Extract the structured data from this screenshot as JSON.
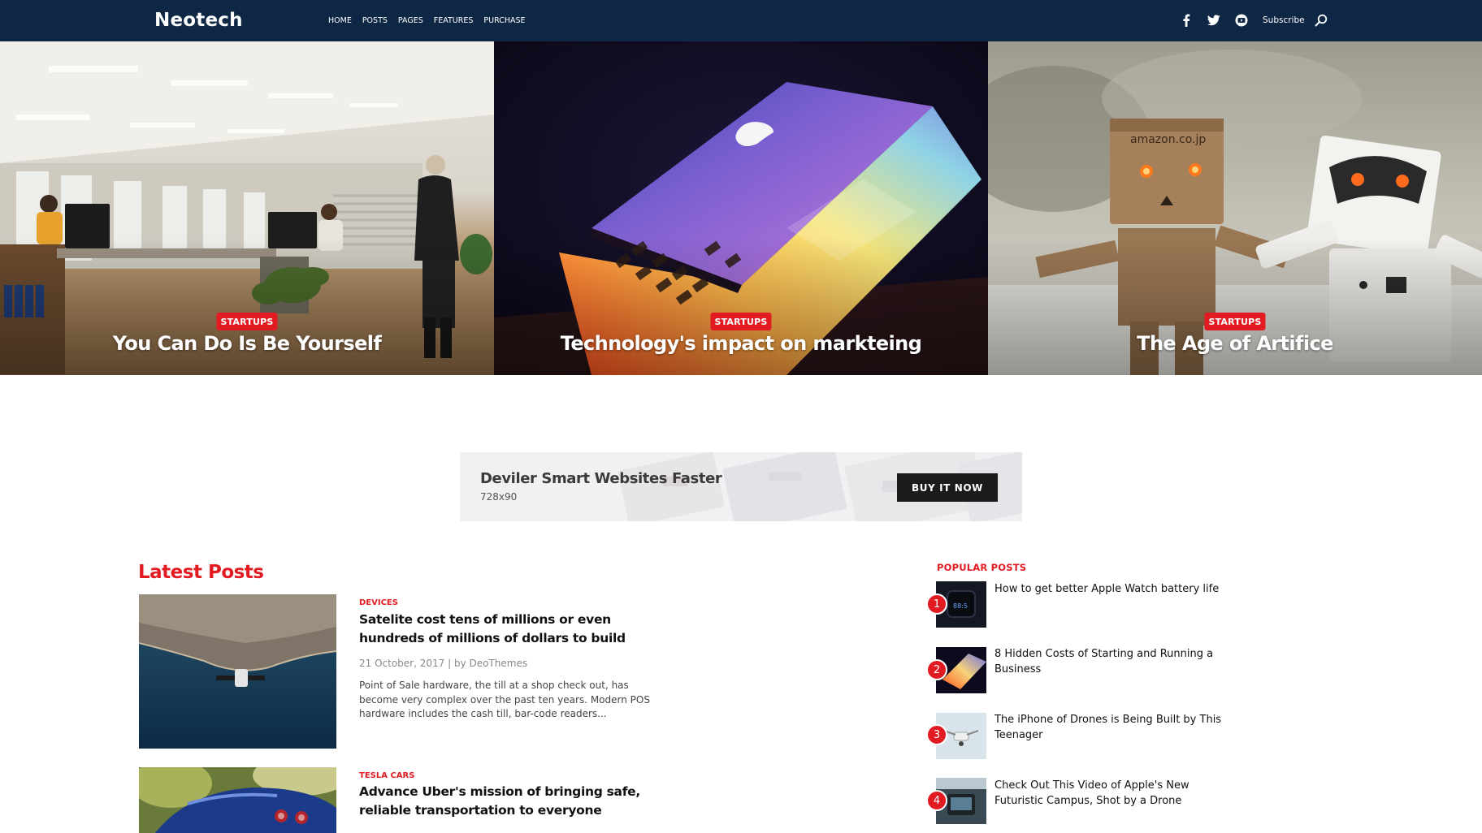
{
  "brand": {
    "logo": "Neotech"
  },
  "nav": {
    "items": [
      "HOME",
      "POSTS",
      "PAGES",
      "FEATURES",
      "PURCHASE"
    ],
    "subscribe_label": "Subscribe",
    "icons": [
      "facebook-icon",
      "twitter-icon",
      "youtube-icon",
      "search-icon"
    ]
  },
  "hero": [
    {
      "category": "STARTUPS",
      "title": "You Can Do Is Be Yourself"
    },
    {
      "category": "STARTUPS",
      "title": "Technology's impact on markteing"
    },
    {
      "category": "STARTUPS",
      "title": "The Age of Artifice"
    }
  ],
  "ad": {
    "title": "Deviler Smart Websites Faster",
    "size": "728x90",
    "button": "BUY IT NOW"
  },
  "latest": {
    "heading": "Latest Posts",
    "posts": [
      {
        "category": "DEVICES",
        "title": "Satelite cost tens of millions or even hundreds of millions of dollars to build",
        "meta": "21 October, 2017 | by DeoThemes",
        "excerpt": "Point of Sale hardware, the till at a shop check out, has become very complex over the past ten years. Modern POS hardware includes the cash till, bar-code readers..."
      },
      {
        "category": "TESLA CARS",
        "title": "Advance Uber's mission of bringing safe, reliable transportation to everyone"
      }
    ]
  },
  "popular": {
    "heading": "POPULAR POSTS",
    "items": [
      {
        "number": "1",
        "title": "How to get better Apple Watch battery life"
      },
      {
        "number": "2",
        "title": "8 Hidden Costs of Starting and Running a Business"
      },
      {
        "number": "3",
        "title": "The iPhone of Drones is Being Built by This Teenager"
      },
      {
        "number": "4",
        "title": "Check Out This Video of Apple's New Futuristic Campus, Shot by a Drone"
      }
    ]
  },
  "colors": {
    "nav_bg": "#0d2744",
    "accent": "#e21b23",
    "text": "#111111"
  }
}
